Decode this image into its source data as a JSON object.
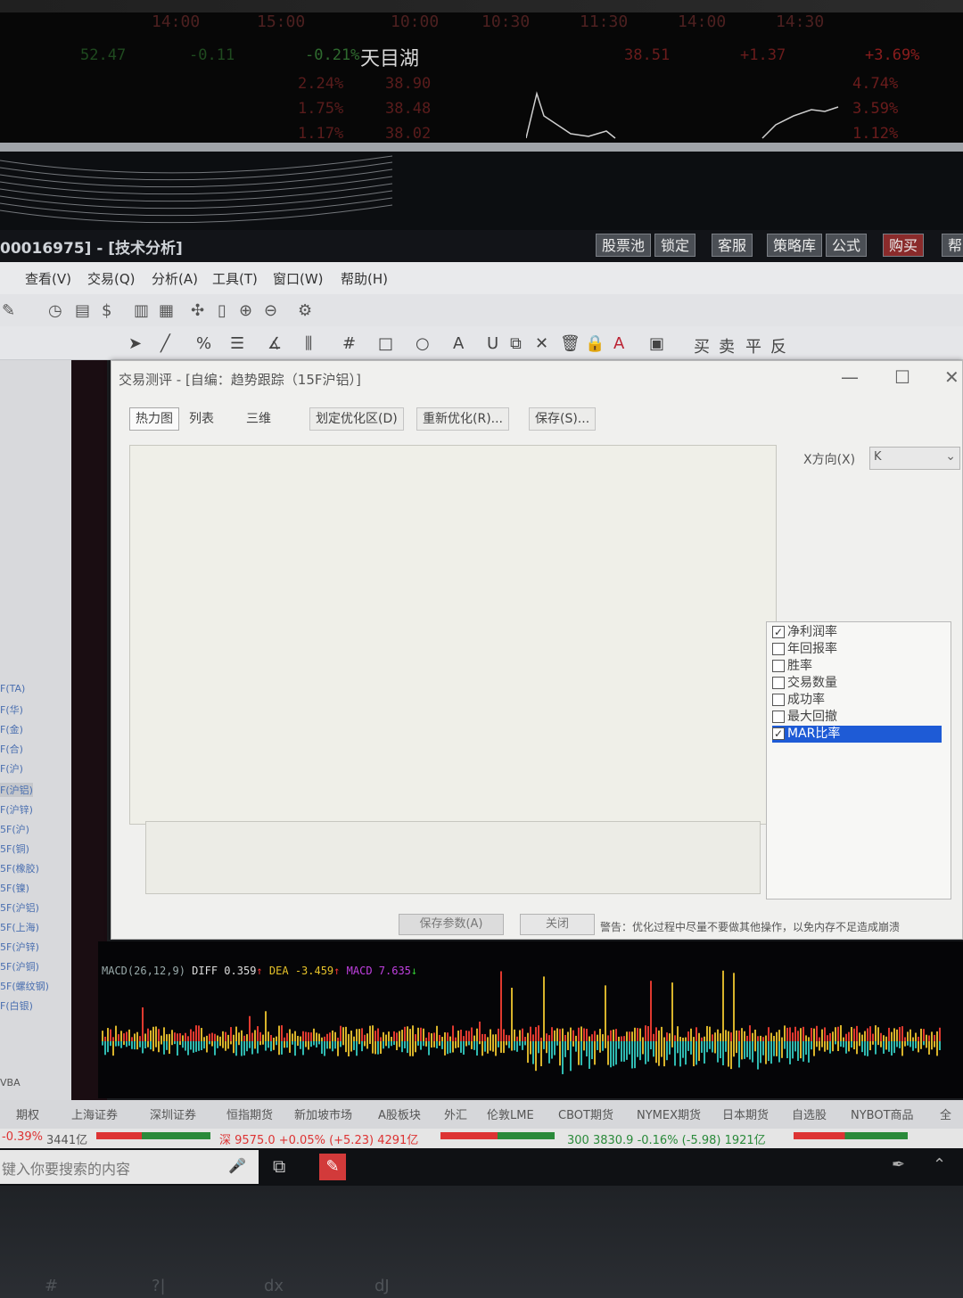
{
  "top_strip": {
    "times": [
      "14:00",
      "15:00",
      "10:00",
      "10:30",
      "11:30",
      "14:00",
      "14:30"
    ],
    "quotes": {
      "left_change": "52.47",
      "left_delta": "-0.11",
      "left_pct": "-0.21%",
      "stock_name": "天目湖",
      "price": "38.51",
      "delta": "+1.37",
      "pct": "+3.69%",
      "levels_left": [
        "2.24%",
        "1.75%",
        "1.17%"
      ],
      "levels_mid": [
        "38.90",
        "38.48",
        "38.02"
      ],
      "levels_right": [
        "4.74%",
        "3.59%",
        "1.12%"
      ]
    }
  },
  "app": {
    "title": "00016975] - [技术分析]",
    "title_buttons": [
      "股票池",
      "锁定",
      "客服",
      "策略库",
      "公式",
      "购买",
      "帮"
    ],
    "menu": [
      "查看(V)",
      "交易(Q)",
      "分析(A)",
      "工具(T)",
      "窗口(W)",
      "帮助(H)"
    ],
    "toolbar2_labels": [
      "买",
      "卖",
      "平",
      "反"
    ]
  },
  "left_panel": {
    "items": [
      "F(TA)",
      "F(华)",
      "F(金)",
      "F(合)",
      "F(沪)",
      "F(沪铝)",
      "F(沪锌)",
      "5F(沪)",
      "5F(铜)",
      "5F(橡胶)",
      "5F(镍)",
      "5F(沪铝)",
      "5F(上海)",
      "5F(沪锌)",
      "5F(沪铜)",
      "5F(螺纹钢)",
      "F(白银)"
    ],
    "bottom_label": "VBA"
  },
  "dialog": {
    "title": "交易测评 - [自编：趋势跟踪（15F沪铝）]",
    "tabs": [
      "热力图",
      "列表",
      "三维",
      "划定优化区(D)",
      "重新优化(R)...",
      "保存(S)..."
    ],
    "x_direction_label": "X方向(X)",
    "x_direction_value": "K",
    "metrics": [
      {
        "label": "净利润率",
        "checked": true,
        "selected": false
      },
      {
        "label": "年回报率",
        "checked": false,
        "selected": false
      },
      {
        "label": "胜率",
        "checked": false,
        "selected": false
      },
      {
        "label": "交易数量",
        "checked": false,
        "selected": false
      },
      {
        "label": "成功率",
        "checked": false,
        "selected": false
      },
      {
        "label": "最大回撤",
        "checked": false,
        "selected": false
      },
      {
        "label": "MAR比率",
        "checked": true,
        "selected": true
      }
    ],
    "buttons": {
      "save_params": "保存参数(A)",
      "close": "关闭"
    },
    "warning": "警告：优化过程中尽量不要做其他操作，以免内存不足造成崩溃"
  },
  "macd": {
    "name": "MACD(26,12,9)",
    "diff_label": "DIFF",
    "diff_value": "0.359",
    "dea_label": "DEA",
    "dea_value": "-3.459",
    "macd_label": "MACD",
    "macd_value": "7.635"
  },
  "bottom_tabs": [
    "期权",
    "上海证券",
    "深圳证券",
    "恒指期货",
    "新加坡市场",
    "A股板块",
    "外汇",
    "伦敦LME",
    "CBOT期货",
    "NYMEX期货",
    "日本期货",
    "自选股",
    "NYBOT商品",
    "全"
  ],
  "ticker": {
    "item1": "-0.39%",
    "item1_amount": "3441亿",
    "item2": "深 9575.0 +0.05% (+5.23) 4291亿",
    "item3": "300 3830.9 -0.16% (-5.98) 1921亿"
  },
  "taskbar": {
    "search_placeholder": "键入你要搜索的内容"
  },
  "keyboard": [
    "#",
    "?|",
    "dx",
    "dJ"
  ],
  "colors": {
    "up": "#d83a3a",
    "down": "#3a9a4a",
    "selection": "#1e5bd6",
    "macd_up": "#e0392f",
    "macd_down": "#2fb9b0"
  }
}
